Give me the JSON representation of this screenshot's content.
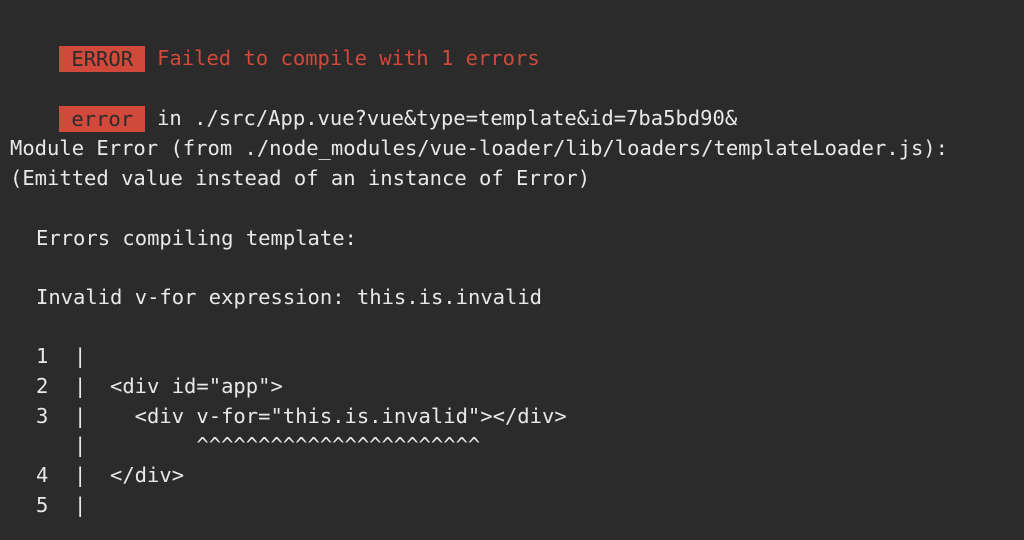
{
  "header": {
    "badge": "ERROR",
    "message": "Failed to compile with 1 errors"
  },
  "error_line": {
    "badge": "error",
    "location": "in ./src/App.vue?vue&type=template&id=7ba5bd90&"
  },
  "module_error": {
    "line1": "Module Error (from ./node_modules/vue-loader/lib/loaders/templateLoader.js):",
    "line2": "(Emitted value instead of an instance of Error)"
  },
  "details": {
    "heading": "Errors compiling template:",
    "message": "Invalid v-for expression: this.is.invalid"
  },
  "code_frame": [
    {
      "num": "1",
      "sep": "|",
      "code": ""
    },
    {
      "num": "2",
      "sep": "|",
      "code": "<div id=\"app\">"
    },
    {
      "num": "3",
      "sep": "|",
      "code": "  <div v-for=\"this.is.invalid\"></div>"
    },
    {
      "num": "",
      "sep": "|",
      "code": "       ^^^^^^^^^^^^^^^^^^^^^^^"
    },
    {
      "num": "4",
      "sep": "|",
      "code": "</div>"
    },
    {
      "num": "5",
      "sep": "|",
      "code": ""
    }
  ],
  "colors": {
    "background": "#2b2b2b",
    "accent_red": "#d0493a",
    "text": "#e8e8e8"
  }
}
